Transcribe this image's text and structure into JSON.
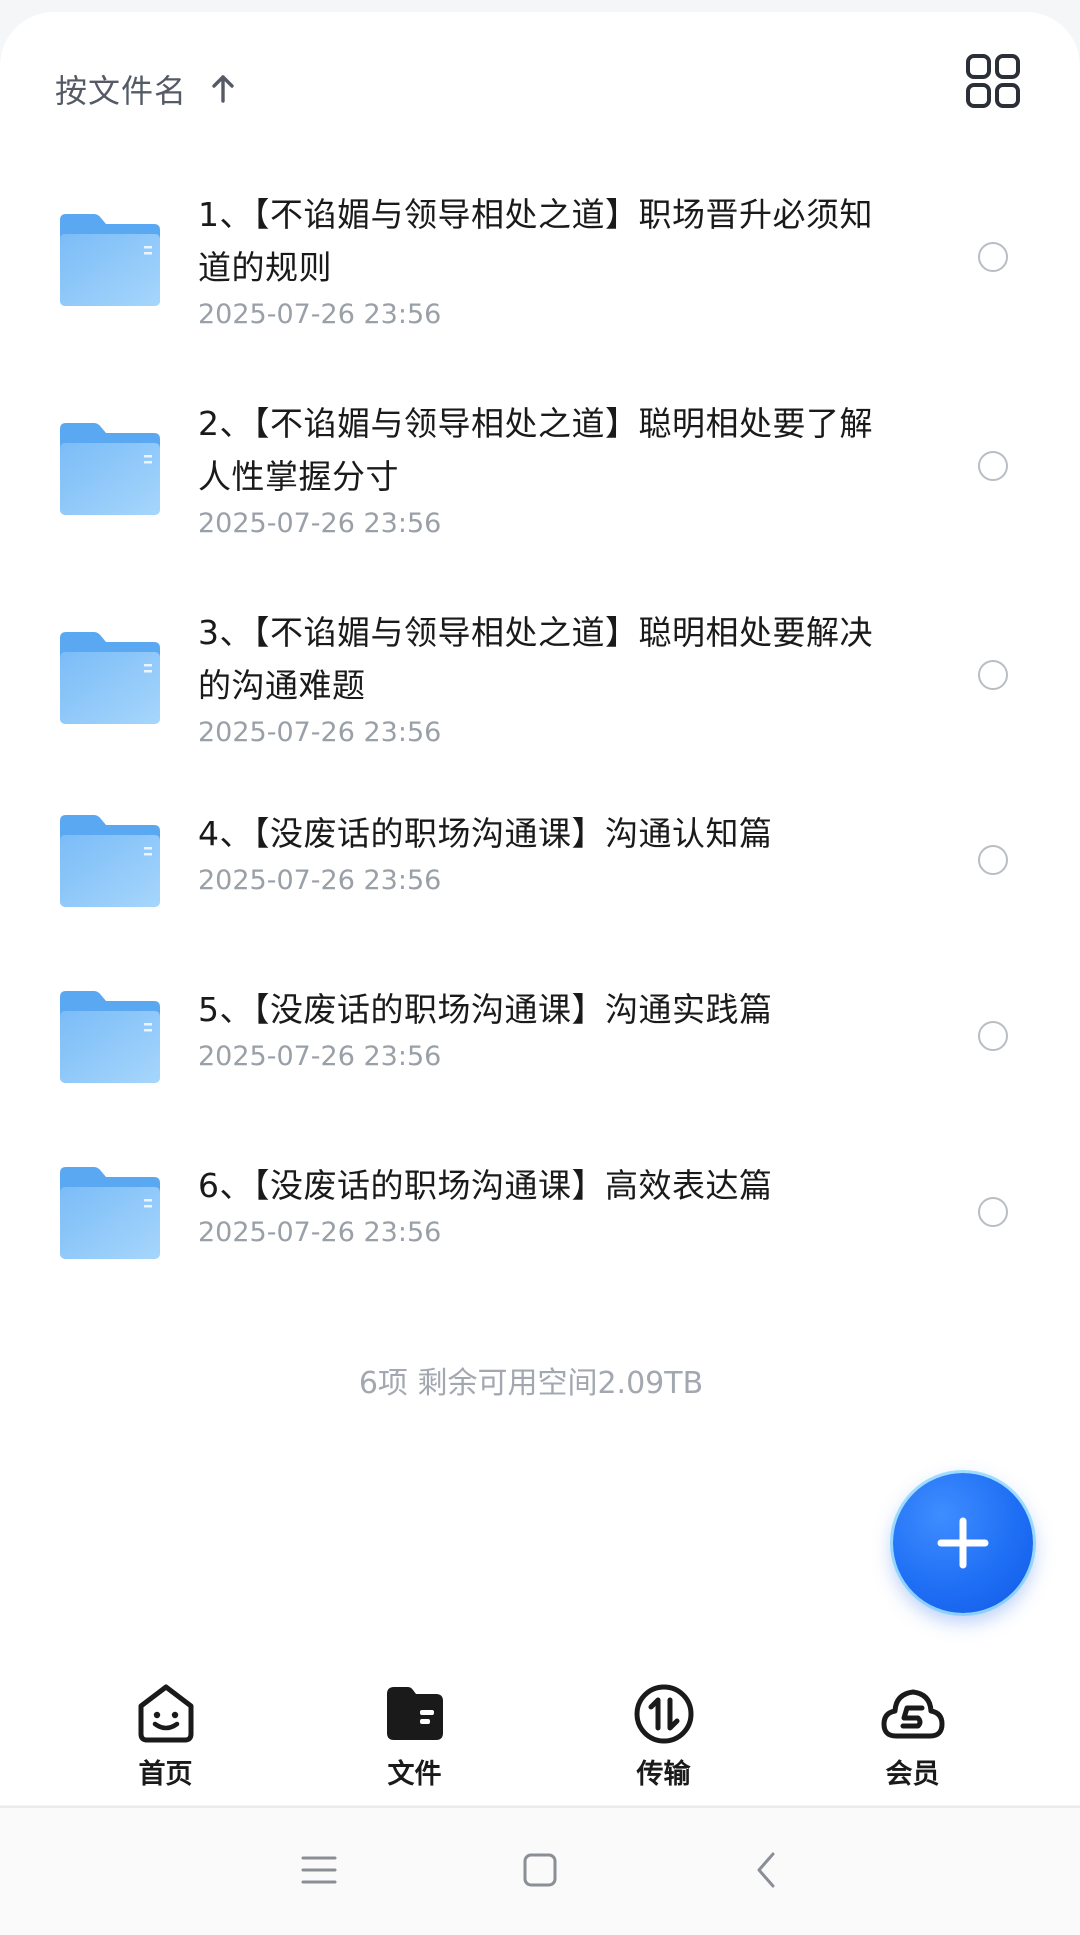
{
  "header": {
    "sort_label": "按文件名",
    "sort_icon": "arrow-up-icon",
    "view_toggle_icon": "grid-view-icon"
  },
  "files": [
    {
      "name": "1、【不谄媚与领导相处之道】职场晋升必须知道的规则",
      "date": "2025-07-26 23:56"
    },
    {
      "name": "2、【不谄媚与领导相处之道】聪明相处要了解人性掌握分寸",
      "date": "2025-07-26 23:56"
    },
    {
      "name": "3、【不谄媚与领导相处之道】聪明相处要解决的沟通难题",
      "date": "2025-07-26 23:56"
    },
    {
      "name": "4、【没废话的职场沟通课】沟通认知篇",
      "date": "2025-07-26 23:56"
    },
    {
      "name": "5、【没废话的职场沟通课】沟通实践篇",
      "date": "2025-07-26 23:56"
    },
    {
      "name": "6、【没废话的职场沟通课】高效表达篇",
      "date": "2025-07-26 23:56"
    }
  ],
  "footer": {
    "summary": "6项 剩余可用空间2.09TB"
  },
  "fab": {
    "icon": "plus-icon",
    "color": "#1f6ff5"
  },
  "tabbar": {
    "items": [
      {
        "label": "首页",
        "icon": "home-smile-icon"
      },
      {
        "label": "文件",
        "icon": "folder-icon"
      },
      {
        "label": "传输",
        "icon": "transfer-icon"
      },
      {
        "label": "会员",
        "icon": "cloud-vip-icon"
      }
    ],
    "active_index": 1
  },
  "system_nav": {
    "icons": [
      "menu-icon",
      "home-square-icon",
      "back-icon"
    ]
  },
  "colors": {
    "folder": "#7cbef7",
    "accent": "#1f6ff5",
    "text_primary": "#1a1a1a",
    "text_secondary": "#9aa0a8"
  }
}
